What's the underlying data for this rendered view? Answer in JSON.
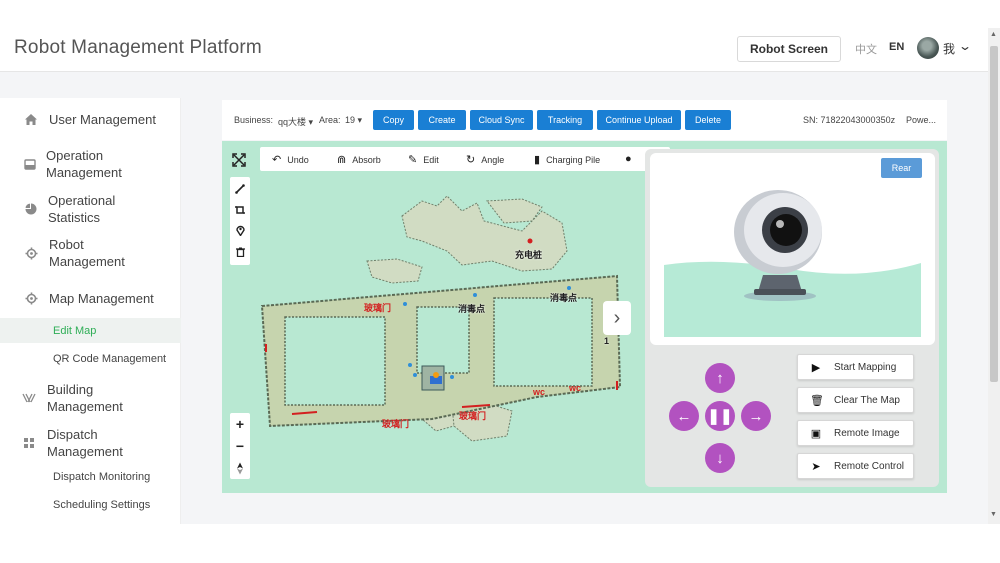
{
  "header": {
    "title": "Robot Management Platform",
    "robot_screen": "Robot Screen",
    "lang_zh": "中文",
    "lang_en": "EN",
    "user_name": "我"
  },
  "sidebar": {
    "items": [
      {
        "label": "User Management",
        "icon": "home-icon"
      },
      {
        "label": "Operation Management",
        "icon": "inbox-icon"
      },
      {
        "label": "Operational Statistics",
        "icon": "pie-chart-icon"
      },
      {
        "label": "Robot Management",
        "icon": "gear-icon"
      },
      {
        "label": "Map Management",
        "icon": "gear-icon"
      },
      {
        "label": "Edit Map",
        "sub": true,
        "active": true
      },
      {
        "label": "QR Code Management",
        "sub": true
      },
      {
        "label": "Building Management",
        "icon": "building-icon"
      },
      {
        "label": "Dispatch Management",
        "icon": "grid-icon"
      },
      {
        "label": "Dispatch Monitoring",
        "sub": true
      },
      {
        "label": "Scheduling Settings",
        "sub": true
      }
    ]
  },
  "toolbar": {
    "business_label": "Business:",
    "business_value": "qq大楼",
    "area_label": "Area:",
    "area_value": "19",
    "buttons": [
      "Copy",
      "Create",
      "Cloud Sync",
      "Tracking",
      "Continue Upload",
      "Delete"
    ],
    "sn": "SN: 71822043000350z",
    "power": "Powe..."
  },
  "map_tools": {
    "undo": "Undo",
    "absorb": "Absorb",
    "edit": "Edit",
    "angle": "Angle",
    "charging_pile": "Charging Pile"
  },
  "map_labels": {
    "charging": "充电桩",
    "disinfect_1": "消毒点",
    "disinfect_2": "消毒点",
    "glass_door_1": "玻璃门",
    "glass_door_2": "玻璃门",
    "glass_door_3": "玻璃门",
    "wc_1": "wc",
    "wc_2": "wc",
    "one": "1"
  },
  "robot_panel": {
    "rear": "Rear",
    "actions": [
      "Start Mapping",
      "Clear The Map",
      "Remote Image",
      "Remote Control"
    ]
  },
  "colors": {
    "primary": "#1a7fd4",
    "active_green": "#2fae57",
    "map_bg": "#b8e8d2",
    "dpad": "#b252c0"
  }
}
